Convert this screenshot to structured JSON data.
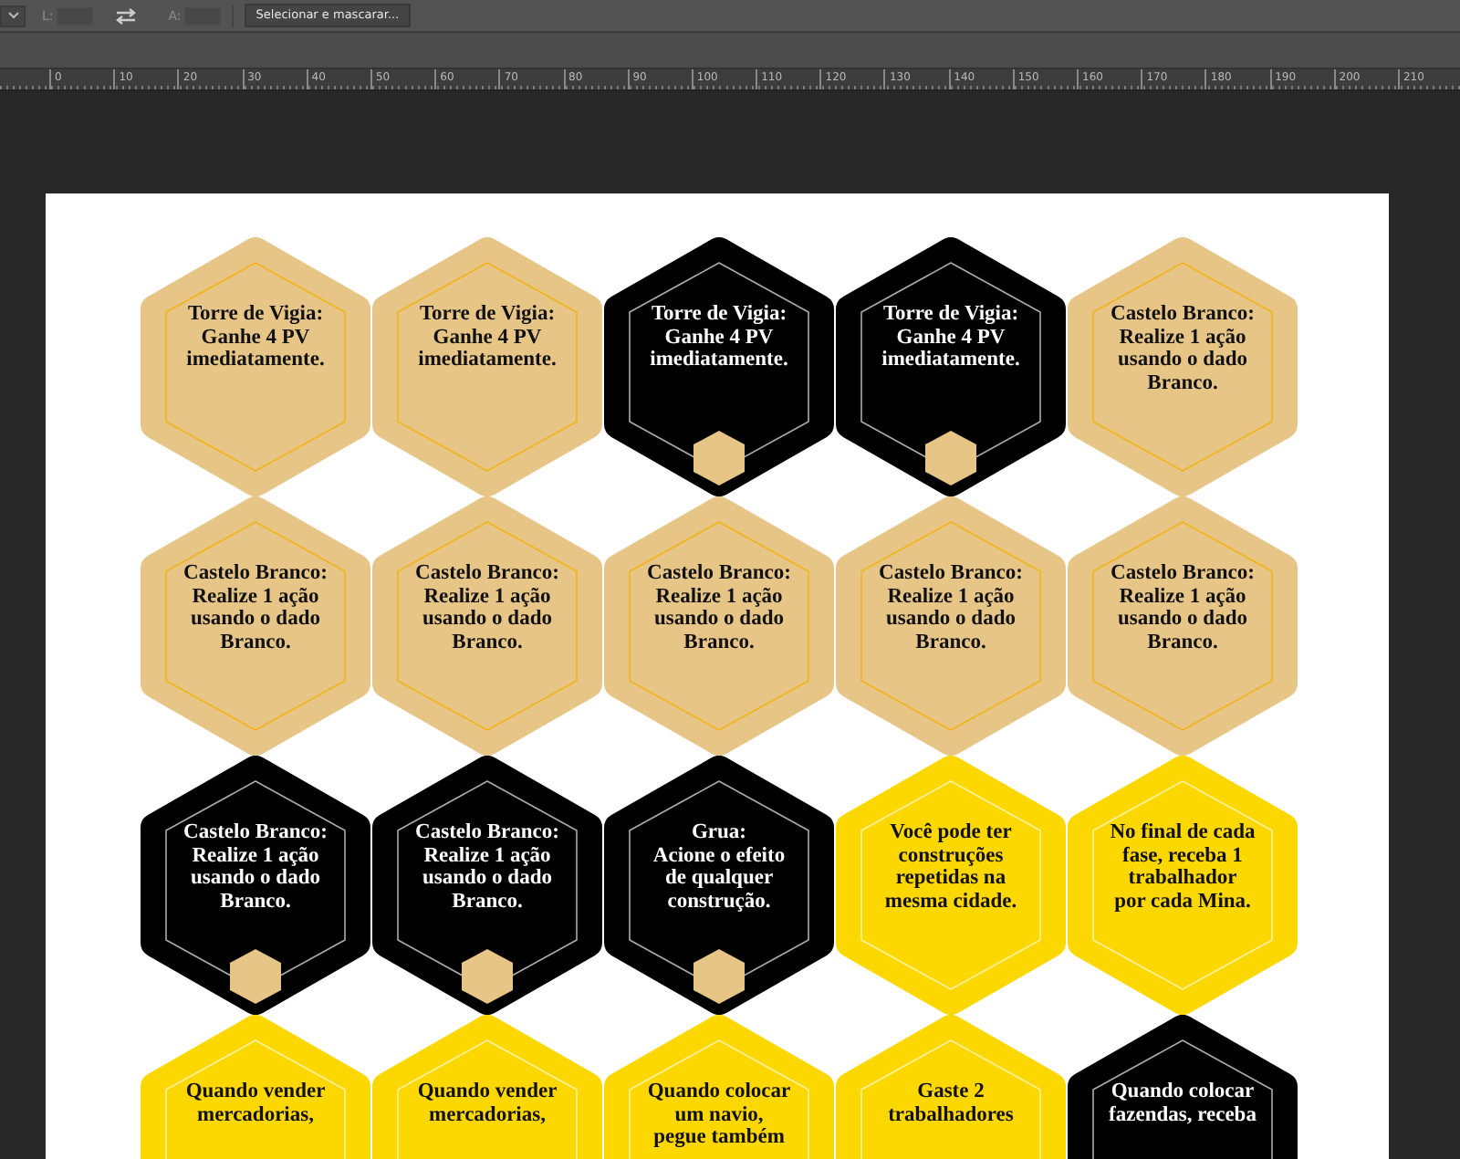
{
  "options_bar": {
    "width_label": "L:",
    "height_label": "A:",
    "select_mask_button": "Selecionar e mascarar..."
  },
  "ruler": {
    "labels": [
      "0",
      "10",
      "20",
      "30",
      "40",
      "50",
      "60",
      "70",
      "80",
      "90",
      "100",
      "110",
      "120",
      "130",
      "140",
      "150",
      "160",
      "170",
      "180",
      "190",
      "200",
      "210"
    ]
  },
  "cards": [
    {
      "kind": "tan",
      "badge": false,
      "text": "Torre de Vigia:\nGanhe 4 PV\nimediatamente."
    },
    {
      "kind": "tan",
      "badge": false,
      "text": "Torre de Vigia:\nGanhe 4 PV\nimediatamente."
    },
    {
      "kind": "black",
      "badge": true,
      "text": "Torre de Vigia:\nGanhe 4 PV\nimediatamente."
    },
    {
      "kind": "black",
      "badge": true,
      "text": "Torre de Vigia:\nGanhe 4 PV\nimediatamente."
    },
    {
      "kind": "tan",
      "badge": false,
      "text": "Castelo Branco:\nRealize 1 ação\nusando o dado\nBranco."
    },
    {
      "kind": "tan",
      "badge": false,
      "text": "Castelo Branco:\nRealize 1 ação\nusando o dado\nBranco."
    },
    {
      "kind": "tan",
      "badge": false,
      "text": "Castelo Branco:\nRealize 1 ação\nusando o dado\nBranco."
    },
    {
      "kind": "tan",
      "badge": false,
      "text": "Castelo Branco:\nRealize 1 ação\nusando o dado\nBranco."
    },
    {
      "kind": "tan",
      "badge": false,
      "text": "Castelo Branco:\nRealize 1 ação\nusando o dado\nBranco."
    },
    {
      "kind": "tan",
      "badge": false,
      "text": "Castelo Branco:\nRealize 1 ação\nusando o dado\nBranco."
    },
    {
      "kind": "black",
      "badge": true,
      "text": "Castelo Branco:\nRealize 1 ação\nusando o dado\nBranco."
    },
    {
      "kind": "black",
      "badge": true,
      "text": "Castelo Branco:\nRealize 1 ação\nusando o dado\nBranco."
    },
    {
      "kind": "black",
      "badge": true,
      "text": "Grua:\nAcione o efeito\nde qualquer\nconstrução."
    },
    {
      "kind": "yellow",
      "badge": false,
      "text": "Você pode ter\nconstruções\nrepetidas na\nmesma cidade."
    },
    {
      "kind": "yellow",
      "badge": false,
      "text": "No final de cada\nfase, receba 1\ntrabalhador\npor cada Mina."
    },
    {
      "kind": "yellow",
      "badge": false,
      "text": "Quando vender\nmercadorias,"
    },
    {
      "kind": "yellow",
      "badge": false,
      "text": "Quando vender\nmercadorias,"
    },
    {
      "kind": "yellow",
      "badge": false,
      "text": "Quando colocar\num navio,\npegue também"
    },
    {
      "kind": "yellow",
      "badge": false,
      "text": "Gaste 2\ntrabalhadores"
    },
    {
      "kind": "black",
      "badge": false,
      "text": "Quando colocar\nfazendas, receba"
    }
  ]
}
